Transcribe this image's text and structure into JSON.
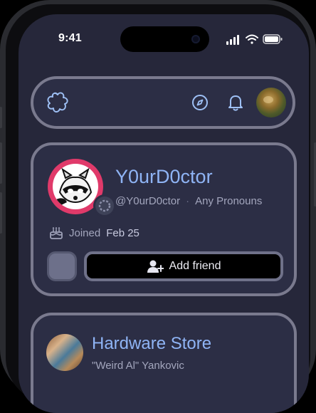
{
  "status_bar": {
    "time": "9:41"
  },
  "profile": {
    "display_name": "Y0urD0ctor",
    "handle": "@Y0urD0ctor",
    "separator": "·",
    "pronouns": "Any Pronouns",
    "joined_label": "Joined",
    "joined_date": "Feb 25",
    "add_friend_label": "Add friend"
  },
  "now_playing": {
    "title": "Hardware Store",
    "artist": "\"Weird Al\" Yankovic"
  },
  "colors": {
    "accent_name": "#8fb4f5",
    "card_bg": "#2c2e45",
    "card_border": "#7a7a8e",
    "screen_bg": "#26273a",
    "pfp_ring": "#e03a6a"
  },
  "icons": {
    "logo": "flower-logo-icon",
    "explore": "compass-icon",
    "notifications": "bell-icon",
    "joined": "cake-icon",
    "add_friend": "person-plus-icon"
  }
}
